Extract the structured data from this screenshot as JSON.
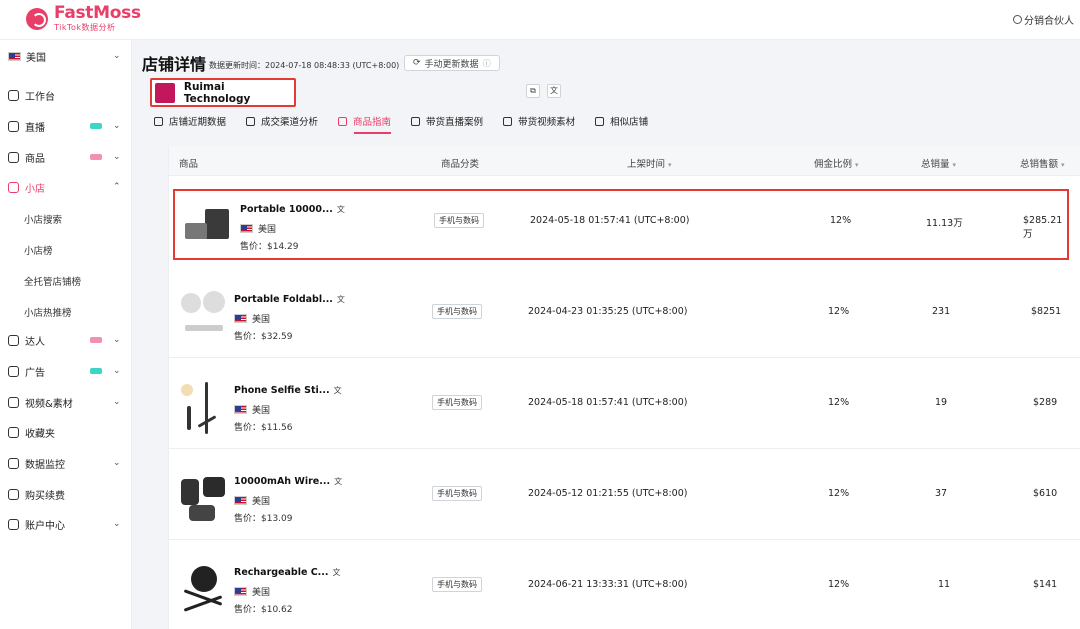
{
  "brand": {
    "name": "FastMoss",
    "sub": "TikTok数据分析"
  },
  "topbar": {
    "partner": "分销合伙人"
  },
  "sidebar": {
    "region": "美国",
    "items": [
      {
        "label": "工作台"
      },
      {
        "label": "直播",
        "badge_color": "#3dd6c4"
      },
      {
        "label": "商品",
        "badge_color": "#f48fb1"
      },
      {
        "label": "小店"
      },
      {
        "label": "达人",
        "badge_color": "#f48fb1"
      },
      {
        "label": "广告",
        "badge_color": "#3dd6c4"
      },
      {
        "label": "视频&素材"
      },
      {
        "label": "收藏夹"
      },
      {
        "label": "数据监控"
      },
      {
        "label": "购买续费"
      },
      {
        "label": "账户中心"
      }
    ],
    "sub_items": [
      "小店搜索",
      "小店榜",
      "全托管店铺榜",
      "小店热推榜"
    ]
  },
  "header": {
    "title": "店铺详情",
    "update_time": "数据更新时间：2024-07-18 08:48:33 (UTC+8:00)",
    "update_button": "手动更新数据"
  },
  "store": {
    "name": "Ruimai Technology",
    "accent": "#c2185b"
  },
  "tabs": [
    "店铺近期数据",
    "成交渠道分析",
    "商品指南",
    "带货直播案例",
    "带货视频素材",
    "相似店铺"
  ],
  "table": {
    "columns": [
      "商品",
      "商品分类",
      "上架时间",
      "佣金比例",
      "总销量",
      "总销售额"
    ],
    "rows": [
      {
        "name": "Portable 10000...",
        "country": "美国",
        "price": "售价：$14.29",
        "category": "手机与数码",
        "listed": "2024-05-18 01:57:41 (UTC+8:00)",
        "commission": "12%",
        "sales": "11.13万",
        "revenue": "$285.21万"
      },
      {
        "name": "Portable Foldabl...",
        "country": "美国",
        "price": "售价：$32.59",
        "category": "手机与数码",
        "listed": "2024-04-23 01:35:25 (UTC+8:00)",
        "commission": "12%",
        "sales": "231",
        "revenue": "$8251"
      },
      {
        "name": "Phone Selfie Sti...",
        "country": "美国",
        "price": "售价：$11.56",
        "category": "手机与数码",
        "listed": "2024-05-18 01:57:41 (UTC+8:00)",
        "commission": "12%",
        "sales": "19",
        "revenue": "$289"
      },
      {
        "name": "10000mAh Wire...",
        "country": "美国",
        "price": "售价：$13.09",
        "category": "手机与数码",
        "listed": "2024-05-12 01:21:55 (UTC+8:00)",
        "commission": "12%",
        "sales": "37",
        "revenue": "$610"
      },
      {
        "name": "Rechargeable C...",
        "country": "美国",
        "price": "售价：$10.62",
        "category": "手机与数码",
        "listed": "2024-06-21 13:33:31 (UTC+8:00)",
        "commission": "12%",
        "sales": "11",
        "revenue": "$141"
      }
    ]
  },
  "colors": {
    "accent": "#e83e69",
    "highlight_border": "#e53935"
  }
}
